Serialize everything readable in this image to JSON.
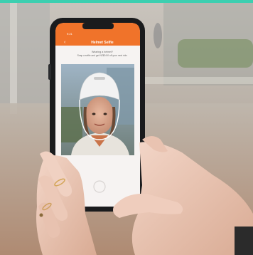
{
  "photo": {
    "description_free": true,
    "colors": {
      "accent": "#f0732a",
      "top_strip": "#3ccfb0",
      "screen_bg": "#f6f3f2",
      "phone_body": "#1a1b1d",
      "helmet": "#f2f2f2"
    }
  },
  "phone_screen": {
    "status_time": "9:21",
    "header_title": "Helmet Selfie",
    "prompt_heading": "Wearing a helmet?",
    "prompt_body": "Snap a selfie and get NZ$0.50 off your next ride."
  }
}
